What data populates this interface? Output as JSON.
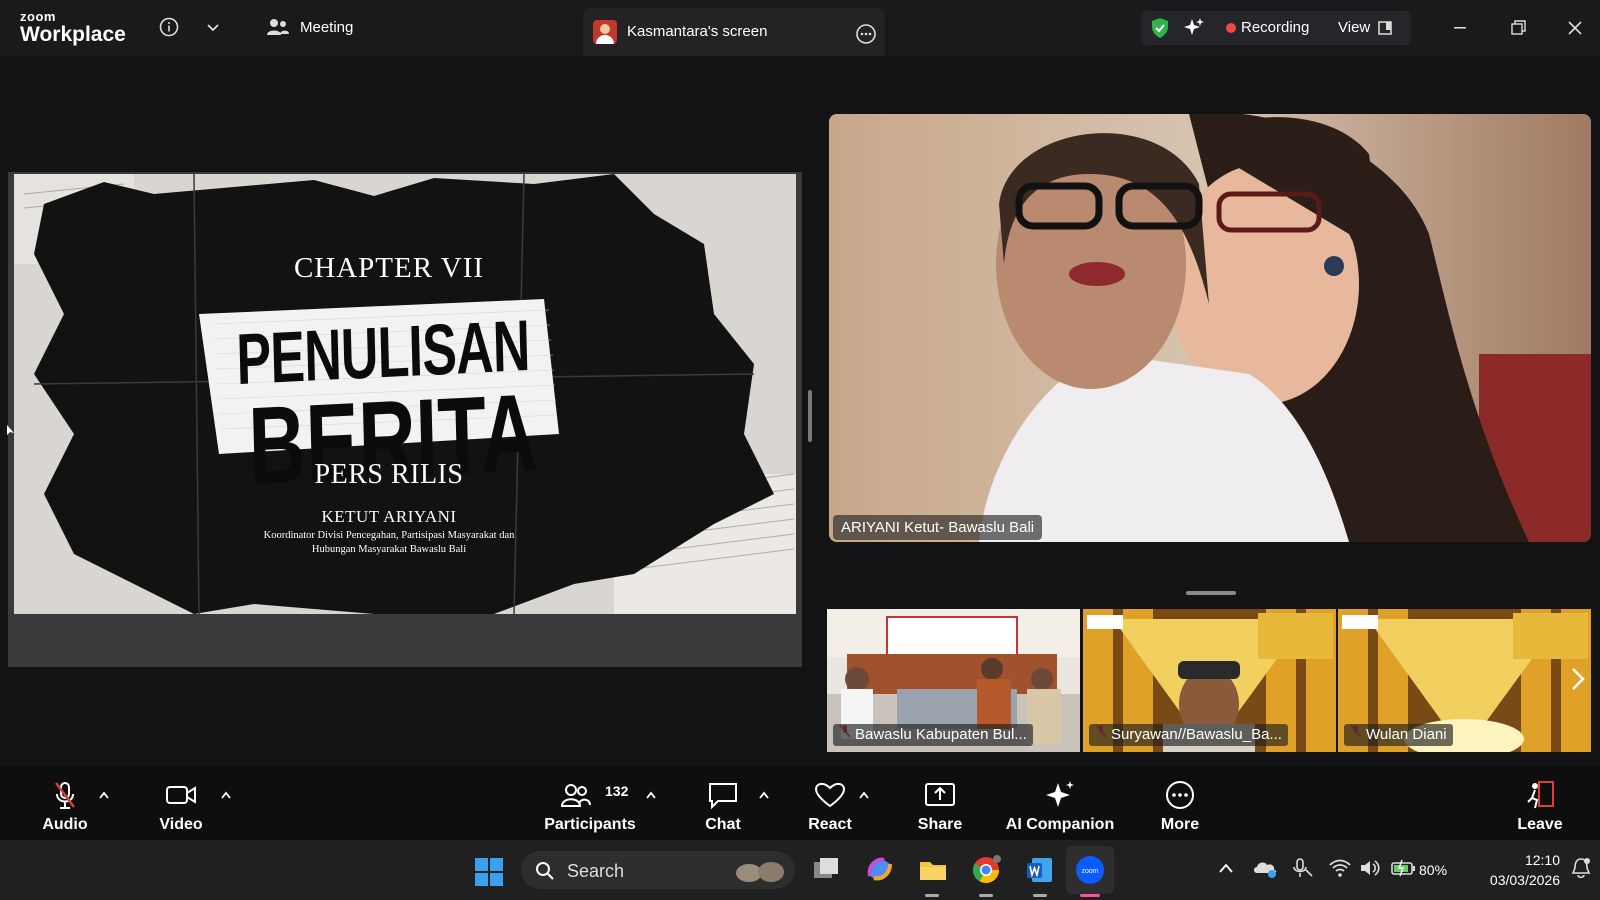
{
  "app": {
    "logo_line1": "zoom",
    "logo_line2": "Workplace"
  },
  "header": {
    "meeting_tab": "Meeting",
    "screen_tab": "Kasmantara's screen",
    "recording_label": "Recording",
    "view_label": "View"
  },
  "slide": {
    "chapter": "CHAPTER VII",
    "title_line1": "PENULISAN",
    "title_line2": "BERITA",
    "subtitle": "PERS RILIS",
    "speaker": "KETUT ARIYANI",
    "role_line1": "Koordinator Divisi Pencegahan, Partisipasi Masyarakat dan",
    "role_line2": "Hubungan Masyarakat Bawaslu Bali"
  },
  "active_speaker": {
    "name": "ARIYANI Ketut- Bawaslu Bali"
  },
  "thumbnails": [
    {
      "name": "Bawaslu Kabupaten Bul..."
    },
    {
      "name": "Suryawan//Bawaslu_Ba..."
    },
    {
      "name": "Wulan Diani"
    }
  ],
  "toolbar": {
    "audio": "Audio",
    "video": "Video",
    "participants": "Participants",
    "participants_count": "132",
    "chat": "Chat",
    "react": "React",
    "share": "Share",
    "ai_companion": "AI Companion",
    "more": "More",
    "leave": "Leave"
  },
  "taskbar": {
    "search_label": "Search",
    "battery": "80%",
    "time": "12:10",
    "date": "03/03/2026"
  },
  "colors": {
    "recording": "#f04848",
    "shield": "#2fb34a",
    "zoom_blue": "#0b5cff",
    "leave_red": "#e03c3c"
  }
}
